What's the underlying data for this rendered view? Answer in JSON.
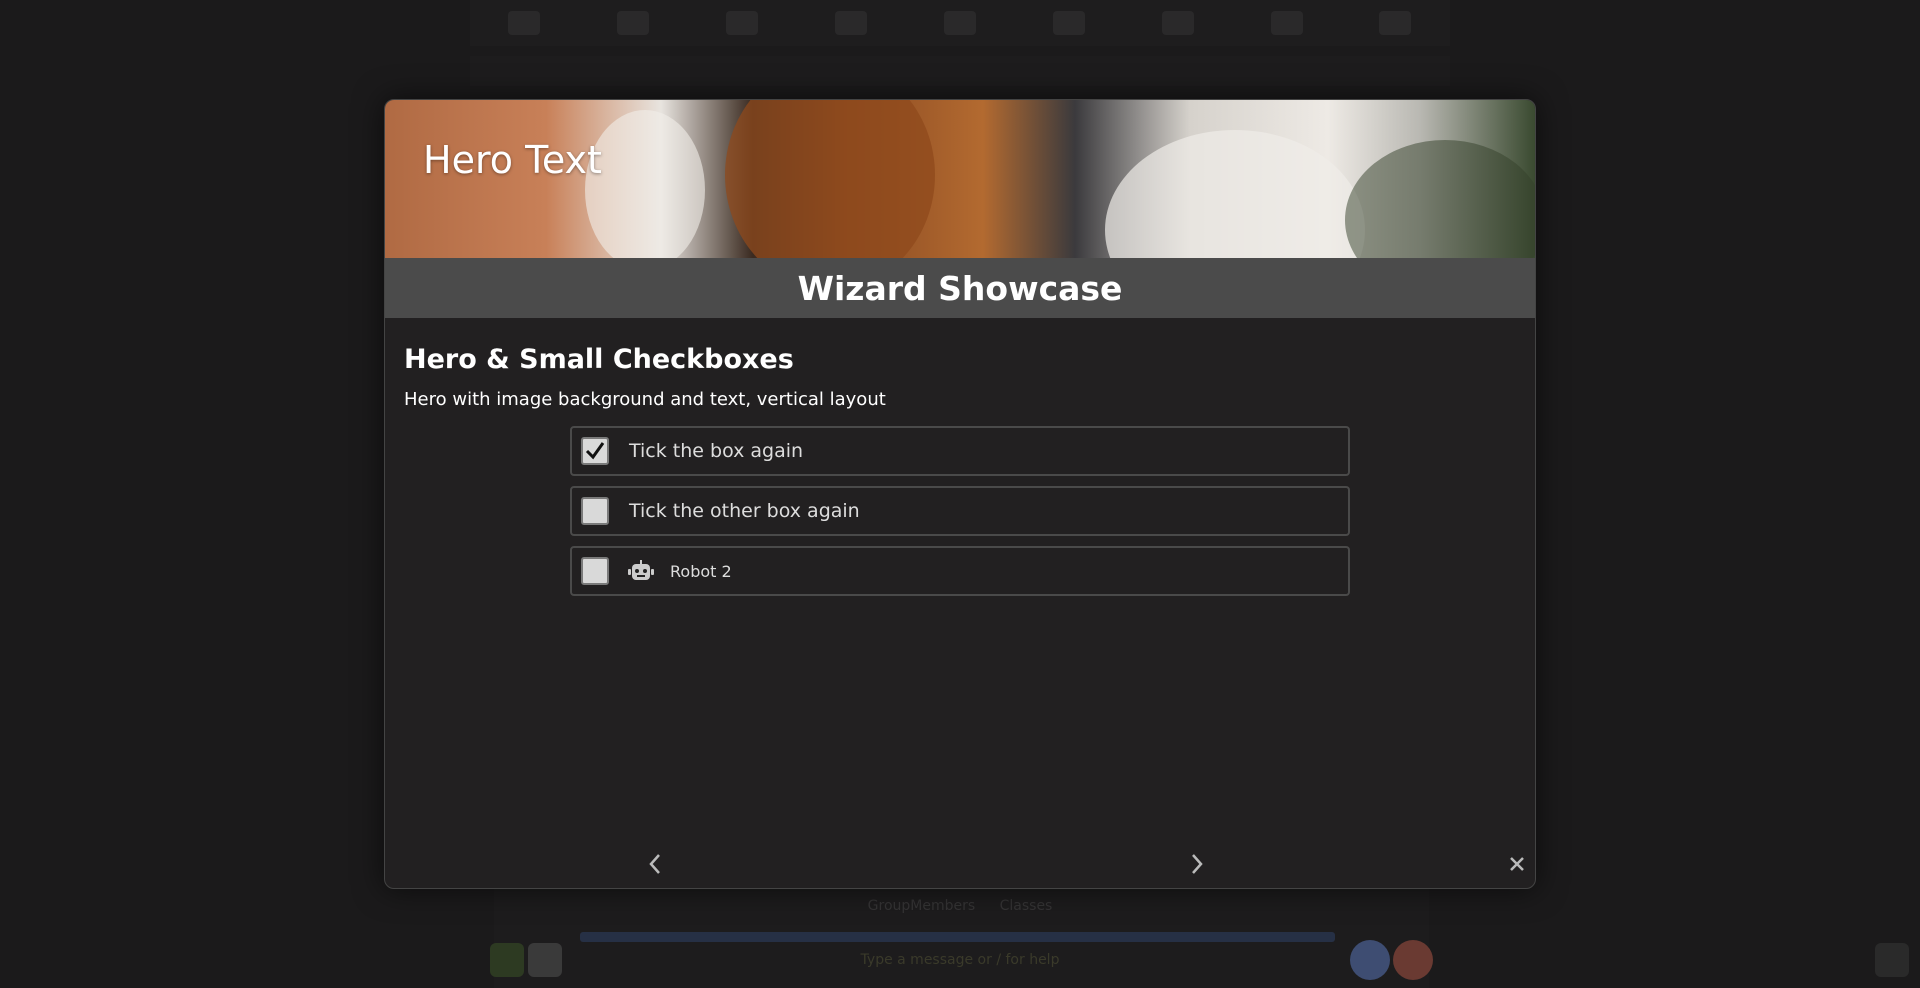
{
  "background": {
    "footer_links": [
      "GroupMembers",
      "Classes"
    ],
    "input_hint": "Type a message or / for help"
  },
  "wizard": {
    "hero_text": "Hero Text",
    "title": "Wizard Showcase",
    "section_heading": "Hero & Small Checkboxes",
    "description": "Hero with image background and text, vertical layout",
    "items": [
      {
        "label": "Tick the box again",
        "checked": true,
        "icon": null
      },
      {
        "label": "Tick the other box again",
        "checked": false,
        "icon": null
      },
      {
        "label": "Robot 2",
        "checked": false,
        "icon": "robot-icon"
      }
    ],
    "nav": {
      "prev_icon": "chevron-left-icon",
      "next_icon": "chevron-right-icon",
      "close_icon": "close-icon"
    }
  },
  "colors": {
    "background": "#1b1a1b",
    "modal": "#222021",
    "title_bar": "#4b4b4b",
    "checkbox": "#d9d9d9"
  }
}
